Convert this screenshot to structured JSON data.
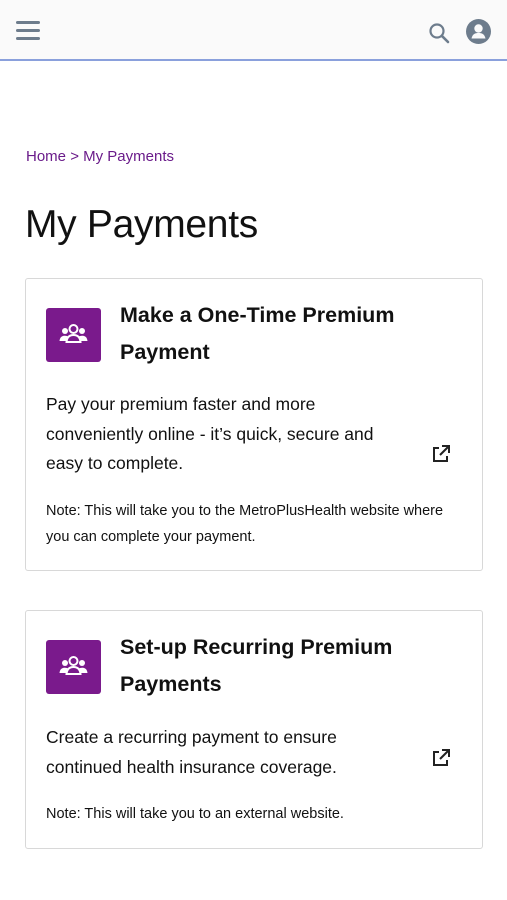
{
  "header": {
    "menu_icon": "hamburger-menu-icon",
    "search_icon": "search-icon",
    "account_icon": "user-account-icon"
  },
  "breadcrumb": {
    "home": "Home",
    "separator": ">",
    "current": "My Payments"
  },
  "page": {
    "title": "My Payments"
  },
  "cards": [
    {
      "icon": "members-group-icon",
      "title": "Make a One-Time Premium Payment",
      "description": "Pay your premium faster and more conveniently online - it’s quick, secure and easy to complete.",
      "note": "Note: This will take you to the MetroPlusHealth website where you can complete your payment.",
      "action_icon": "external-link-icon"
    },
    {
      "icon": "members-group-icon",
      "title": "Set-up Recurring Premium Payments",
      "description": "Create a recurring payment to ensure continued health insurance coverage.",
      "note": "Note: This will take you to an external website.",
      "action_icon": "external-link-icon"
    }
  ],
  "colors": {
    "brand_purple": "#7a1a8c",
    "link_purple": "#6a1b8a",
    "header_border": "#8aa0dc",
    "icon_gray": "#6d7c8c"
  }
}
